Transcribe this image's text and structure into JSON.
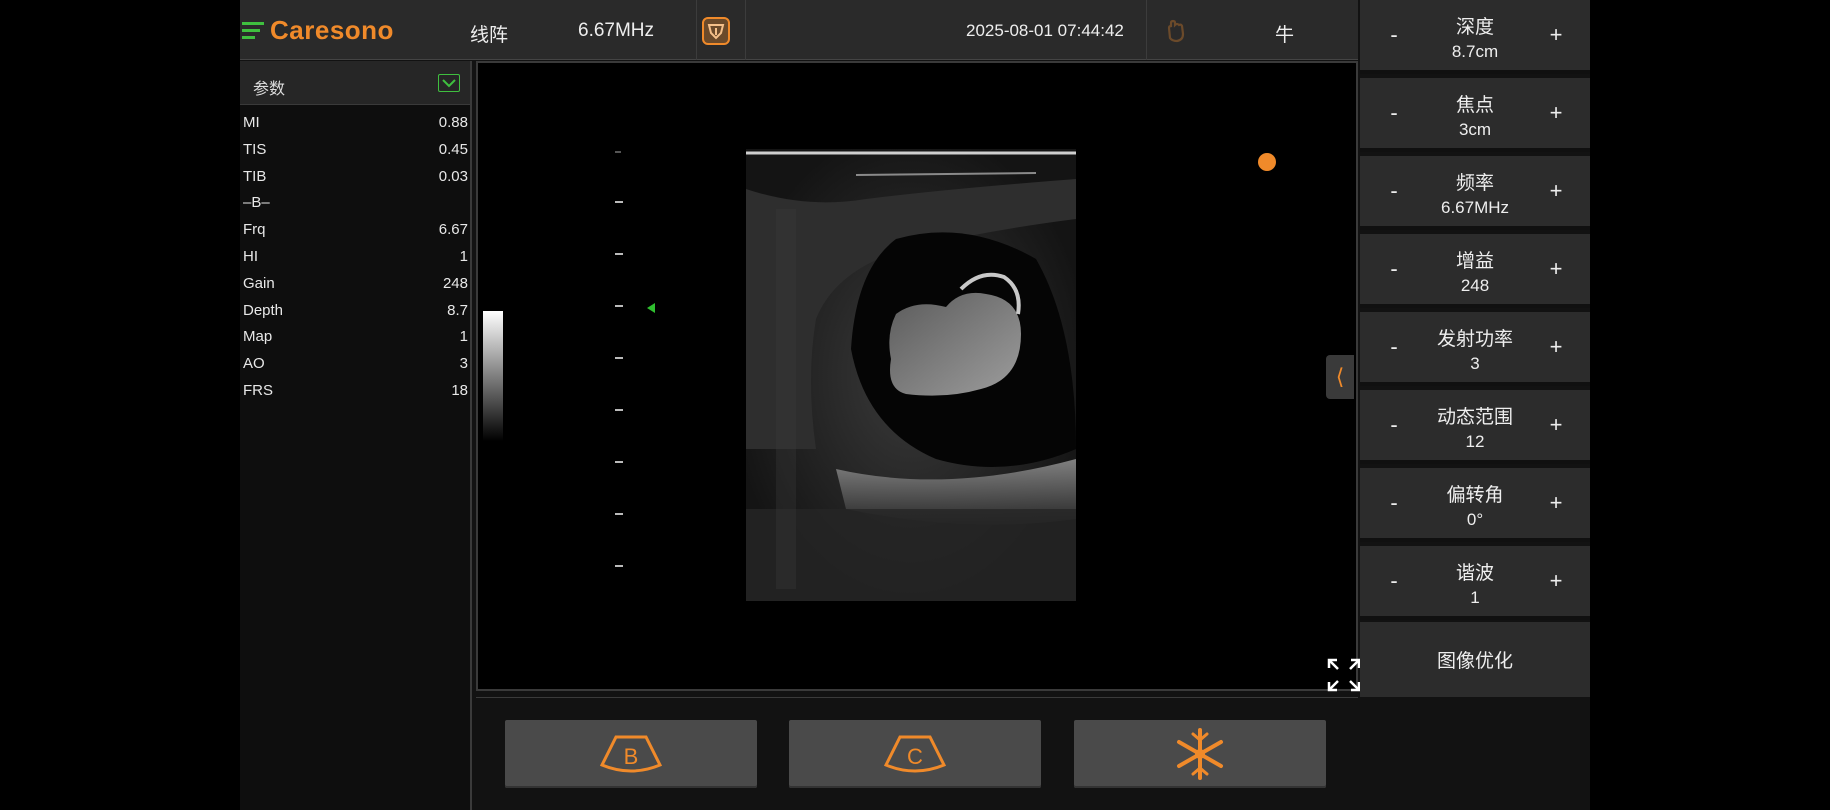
{
  "header": {
    "logo_text": "Caresono",
    "probe": "线阵",
    "frequency": "6.67MHz",
    "datetime": "2025-08-01 07:44:42",
    "animal": "牛"
  },
  "params": {
    "title": "参数",
    "rows": [
      {
        "name": "MI",
        "value": "0.88"
      },
      {
        "name": "TIS",
        "value": "0.45"
      },
      {
        "name": "TIB",
        "value": "0.03"
      },
      {
        "name": "–B–",
        "value": ""
      },
      {
        "name": "Frq",
        "value": "6.67"
      },
      {
        "name": "HI",
        "value": "1"
      },
      {
        "name": "Gain",
        "value": "248"
      },
      {
        "name": "Depth",
        "value": "8.7"
      },
      {
        "name": "Map",
        "value": "1"
      },
      {
        "name": "AO",
        "value": "3"
      },
      {
        "name": "FRS",
        "value": "18"
      }
    ]
  },
  "controls": [
    {
      "label": "深度",
      "value": "8.7cm"
    },
    {
      "label": "焦点",
      "value": "3cm"
    },
    {
      "label": "频率",
      "value": "6.67MHz"
    },
    {
      "label": "增益",
      "value": "248"
    },
    {
      "label": "发射功率",
      "value": "3"
    },
    {
      "label": "动态范围",
      "value": "12"
    },
    {
      "label": "偏转角",
      "value": "0°"
    },
    {
      "label": "谐波",
      "value": "1"
    }
  ],
  "control_minus": "-",
  "control_plus": "+",
  "image_optimize": "图像优化",
  "bottom": {
    "b_mode": "B",
    "c_mode": "C"
  },
  "colors": {
    "accent": "#f08a2a",
    "green": "#3fbf3f"
  }
}
